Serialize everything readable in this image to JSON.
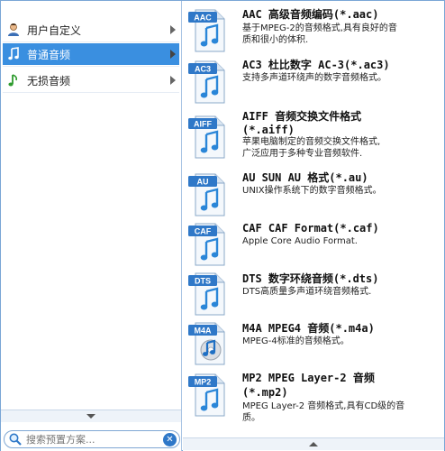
{
  "categories": [
    {
      "label": "用户自定义",
      "icon": "user-icon"
    },
    {
      "label": "普通音频",
      "icon": "music-note-icon",
      "selected": true
    },
    {
      "label": "无损音频",
      "icon": "green-note-icon"
    }
  ],
  "search": {
    "placeholder": "搜索预置方案..."
  },
  "formats": [
    {
      "badge": "AAC",
      "title": "AAC 高级音频编码(*.aac)",
      "desc": [
        "基于MPEG-2的音频格式,具有良好的音",
        "质和很小的体积."
      ]
    },
    {
      "badge": "AC3",
      "title": "AC3 杜比数字 AC-3(*.ac3)",
      "desc": [
        "支持多声道环绕声的数字音频格式。"
      ]
    },
    {
      "badge": "AIFF",
      "title": "AIFF 音频交换文件格式",
      "title2": "(*.aiff)",
      "desc": [
        "苹果电脑制定的音频交换文件格式,",
        "广泛应用于多种专业音频软件."
      ]
    },
    {
      "badge": "AU",
      "title": "AU SUN AU 格式(*.au)",
      "desc": [
        "UNIX操作系统下的数字音频格式。"
      ]
    },
    {
      "badge": "CAF",
      "title": "CAF CAF Format(*.caf)",
      "desc": [
        "Apple Core Audio Format."
      ]
    },
    {
      "badge": "DTS",
      "title": "DTS 数字环绕音频(*.dts)",
      "desc": [
        "DTS高质量多声道环绕音频格式."
      ]
    },
    {
      "badge": "M4A",
      "title": "M4A MPEG4 音频(*.m4a)",
      "desc": [
        "MPEG-4标准的音频格式。"
      ]
    },
    {
      "badge": "MP2",
      "title": "MP2 MPEG Layer-2 音频",
      "title2": "(*.mp2)",
      "desc": [
        "MPEG Layer-2 音频格式,具有CD级的音",
        "质。"
      ]
    }
  ],
  "colors": {
    "accent": "#3a8fe0",
    "badge": "#2f78c8",
    "note": "#2a86d8"
  }
}
